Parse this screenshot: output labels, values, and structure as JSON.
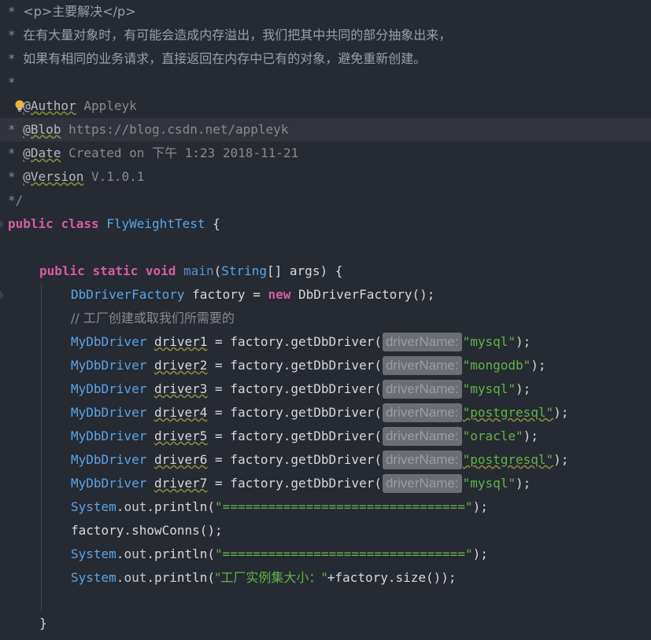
{
  "colors": {
    "background": "#262a33",
    "highlight_line": "#31343d",
    "keyword": "#d45ea6",
    "class_name": "#5aa5e6",
    "string": "#62b543",
    "comment": "#8a8a8a",
    "hint_bg": "#6b6e73"
  },
  "doc": {
    "star": "*",
    "line1": "<p>主要解决</p>",
    "line2": "在有大量对象时，有可能会造成内存溢出，我们把其中共同的部分抽象出来，",
    "line3": "如果有相同的业务请求，直接返回在内存中已有的对象，避免重新创建。",
    "author_tag": "@Author",
    "author_val": "Appleyk",
    "blob_tag": "@Blob",
    "blob_val": "https://blog.csdn.net/appleyk",
    "date_tag": "@Date",
    "date_val": "Created on 下午 1:23 2018-11-21",
    "version_tag": "@Version",
    "version_val": "V.1.0.1",
    "end": "*/"
  },
  "code": {
    "kw_public": "public",
    "kw_class": "class",
    "class_name": "FlyWeightTest",
    "brace_open": "{",
    "brace_close": "}",
    "kw_static": "static",
    "kw_void": "void",
    "main_name": "main",
    "main_params_open": "(",
    "main_param_type": "String",
    "main_params_rest": "[] args) {",
    "factory_type": "DbDriverFactory",
    "factory_decl": " factory = ",
    "kw_new": "new",
    "factory_ctor": " DbDriverFactory();",
    "comment_cn": "// 工厂创建或取我们所需要的",
    "driver_type": "MyDbDriver",
    "assign_call": " = factory.getDbDriver(",
    "hint_label": "driverName:",
    "close_paren": ");",
    "drivers": [
      {
        "var": "driver1",
        "value": "\"mysql\""
      },
      {
        "var": "driver2",
        "value": "\"mongodb\""
      },
      {
        "var": "driver3",
        "value": "\"mysql\""
      },
      {
        "var": "driver4",
        "value": "\"postgresql\""
      },
      {
        "var": "driver5",
        "value": "\"oracle\""
      },
      {
        "var": "driver6",
        "value": "\"postgresql\""
      },
      {
        "var": "driver7",
        "value": "\"mysql\""
      }
    ],
    "system": "System",
    "dot_out": ".",
    "out": "out",
    "println": ".println(",
    "separator": "\"================================\"",
    "show_conns": "factory.showConns();",
    "size_label": "\"工厂实例集大小：\"",
    "size_rest": "+factory.size());"
  }
}
